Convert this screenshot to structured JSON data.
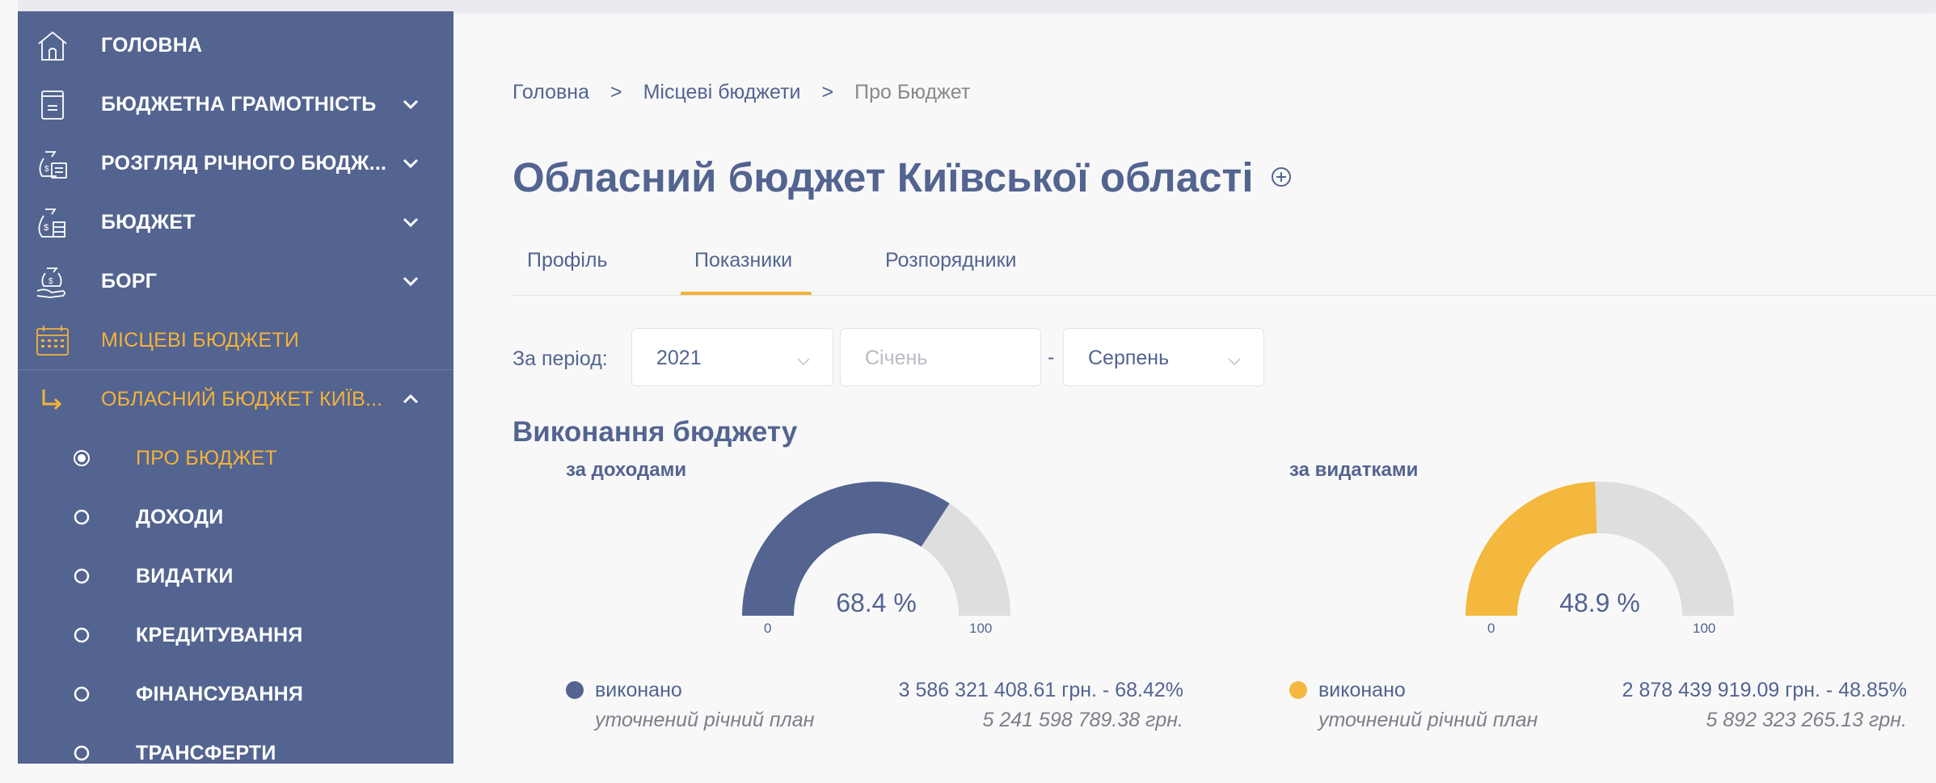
{
  "sidebar": {
    "items": [
      {
        "label": "ГОЛОВНА",
        "icon": "home-icon"
      },
      {
        "label": "БЮДЖЕТНА ГРАМОТНІСТЬ",
        "icon": "document-icon"
      },
      {
        "label": "РОЗГЛЯД РІЧНОГО БЮДЖ...",
        "icon": "money-bag-calculator-icon"
      },
      {
        "label": "БЮДЖЕТ",
        "icon": "money-bag-icon"
      },
      {
        "label": "БОРГ",
        "icon": "hand-money-icon"
      },
      {
        "label": "МІСЦЕВІ БЮДЖЕТИ",
        "icon": "calendar-icon"
      },
      {
        "label": "ОБЛАСНИЙ БЮДЖЕТ КИЇВ...",
        "icon": "arrow-return-icon"
      }
    ],
    "subitems": [
      {
        "label": "ПРО БЮДЖЕТ",
        "selected": true
      },
      {
        "label": "ДОХОДИ",
        "selected": false
      },
      {
        "label": "ВИДАТКИ",
        "selected": false
      },
      {
        "label": "КРЕДИТУВАННЯ",
        "selected": false
      },
      {
        "label": "ФІНАНСУВАННЯ",
        "selected": false
      },
      {
        "label": "ТРАНСФЕРТИ",
        "selected": false
      }
    ]
  },
  "breadcrumb": {
    "items": [
      "Головна",
      "Місцеві бюджети",
      "Про Бюджет"
    ],
    "separator": ">"
  },
  "page": {
    "title": "Обласний бюджет Київської області"
  },
  "tabs": [
    {
      "label": "Профіль"
    },
    {
      "label": "Показники"
    },
    {
      "label": "Розпорядники"
    }
  ],
  "filter": {
    "label": "За період:",
    "year": "2021",
    "month_from_placeholder": "Січень",
    "dash": "-",
    "month_to": "Серпень"
  },
  "execution": {
    "title": "Виконання бюджету",
    "revenue": {
      "subtitle": "за доходами",
      "percent": 68.4,
      "percent_label": "68.4 %",
      "tick_min": "0",
      "tick_max": "100",
      "done_label": "виконано",
      "done_value": "3 586 321 408.61 грн. - 68.42%",
      "plan_label": "уточнений річний план",
      "plan_value": "5 241 598 789.38 грн.",
      "color": "#536490"
    },
    "expenses": {
      "subtitle": "за видатками",
      "percent": 48.9,
      "percent_label": "48.9 %",
      "tick_min": "0",
      "tick_max": "100",
      "done_label": "виконано",
      "done_value": "2 878 439 919.09 грн. - 48.85%",
      "plan_label": "уточнений річний план",
      "plan_value": "5 892 323 265.13 грн.",
      "color": "#f3b83d"
    }
  },
  "colors": {
    "sidebar_bg": "#536490",
    "accent": "#f3b23a",
    "gauge_remainder": "#dedede"
  }
}
